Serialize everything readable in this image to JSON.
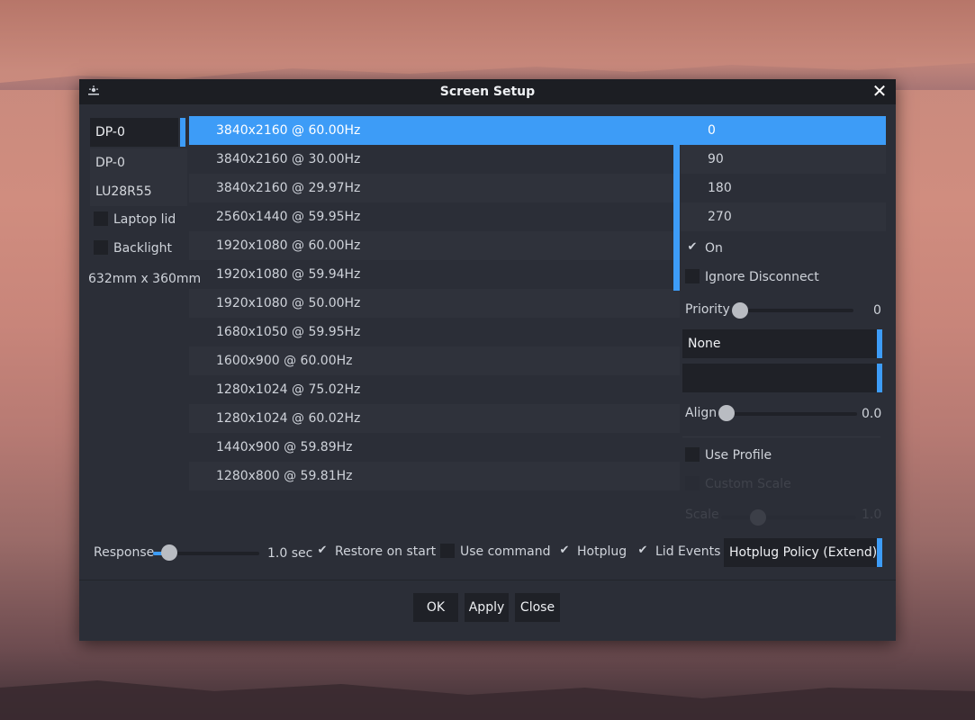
{
  "window": {
    "title": "Screen Setup"
  },
  "outputs": {
    "items": [
      "DP-0",
      "DP-0",
      "LU28R55"
    ]
  },
  "output_options": {
    "laptop_lid": "Laptop lid",
    "backlight": "Backlight",
    "size": "632mm x 360mm"
  },
  "modes": [
    "3840x2160 @ 60.00Hz",
    "3840x2160 @ 30.00Hz",
    "3840x2160 @ 29.97Hz",
    "2560x1440 @ 59.95Hz",
    "1920x1080 @ 60.00Hz",
    "1920x1080 @ 59.94Hz",
    "1920x1080 @ 50.00Hz",
    "1680x1050 @ 59.95Hz",
    "1600x900 @ 60.00Hz",
    "1280x1024 @ 75.02Hz",
    "1280x1024 @ 60.02Hz",
    "1440x900 @ 59.89Hz",
    "1280x800 @ 59.81Hz"
  ],
  "selected_mode": "3840x2160 @ 60.00Hz",
  "rotation": {
    "items": [
      "0",
      "90",
      "180",
      "270"
    ],
    "selected": "0"
  },
  "options": {
    "on": "On",
    "on_checked": true,
    "ignore_disconnect": "Ignore Disconnect",
    "ignore_checked": false
  },
  "priority": {
    "label": "Priority",
    "value": "0",
    "fraction": 0.0
  },
  "dropdowns": {
    "first": "None",
    "second": ""
  },
  "align": {
    "label": "Align",
    "value": "0.0",
    "fraction": 0.0
  },
  "profile": {
    "use_profile": "Use Profile",
    "custom_scale": "Custom Scale",
    "scale_label": "Scale",
    "scale_value": "1.0"
  },
  "bottom": {
    "response_label": "Response",
    "response_value": "1.0 sec",
    "response_fraction": 0.1,
    "restore_on_start": "Restore on start",
    "restore_checked": true,
    "use_command": "Use command",
    "use_command_checked": false,
    "hotplug": "Hotplug",
    "hotplug_checked": true,
    "lid_events": "Lid Events",
    "lid_events_checked": true,
    "hotplug_policy": "Hotplug Policy (Extend)"
  },
  "buttons": {
    "ok": "OK",
    "apply": "Apply",
    "close": "Close"
  },
  "colors": {
    "accent": "#3d9cf7",
    "window_bg": "#2b2e37",
    "titlebar_bg": "#1c1e23"
  }
}
